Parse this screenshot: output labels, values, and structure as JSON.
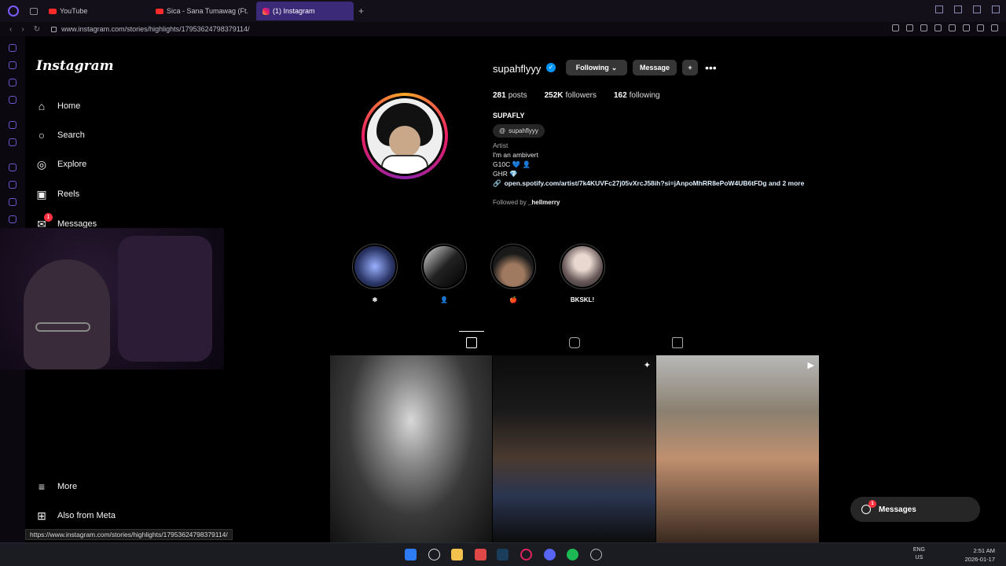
{
  "browser": {
    "tabs": [
      {
        "label": "YouTube",
        "icon": "youtube-icon"
      },
      {
        "label": "Sica - Sana Tumawag (Ft.",
        "icon": "youtube-icon"
      },
      {
        "label": "(1) Instagram",
        "icon": "instagram-icon"
      }
    ],
    "url": "www.instagram.com/stories/highlights/17953624798379114/"
  },
  "nav": {
    "logo": "Instagram",
    "items": [
      {
        "label": "Home",
        "icon": "home-icon"
      },
      {
        "label": "Search",
        "icon": "search-icon"
      },
      {
        "label": "Explore",
        "icon": "compass-icon"
      },
      {
        "label": "Reels",
        "icon": "reels-icon"
      },
      {
        "label": "Messages",
        "icon": "messenger-icon",
        "badge": "1"
      }
    ],
    "more": "More",
    "also_from_meta": "Also from Meta"
  },
  "profile": {
    "username": "supahflyyy",
    "verified_mark": "✓",
    "following_btn": "Following",
    "message_btn": "Message",
    "stats": {
      "posts": "281",
      "posts_label": "posts",
      "followers": "252K",
      "followers_label": "followers",
      "following": "162",
      "following_label": "following"
    },
    "full_name": "SUPAFLY",
    "threads_handle": "supahflyyy",
    "category": "Artist",
    "bio": [
      "I'm an ambivert",
      "G10C 💙 👤",
      "GHR 💎"
    ],
    "link": "open.spotify.com/artist/7k4KUVFc27j05vXrcJ58ih?si=jAnpoMhRR8ePoW4UB6tFDg and 2 more",
    "followed_by_prefix": "Followed by",
    "followed_by": "_hellmerry"
  },
  "highlights": [
    {
      "label": "❄"
    },
    {
      "label": "👤"
    },
    {
      "label": "🍎"
    },
    {
      "label": "BKSKL!"
    }
  ],
  "messages_pill": {
    "label": "Messages",
    "badge": "1"
  },
  "status_url": "https://www.instagram.com/stories/highlights/17953624798379114/",
  "taskbar": {
    "lang": "ENG",
    "region": "US",
    "time": "2:51 AM",
    "date": "2026-01-17"
  },
  "colors": {
    "accent": "#0095f6",
    "badge": "#ff3040",
    "opera": "#7a5cff"
  }
}
